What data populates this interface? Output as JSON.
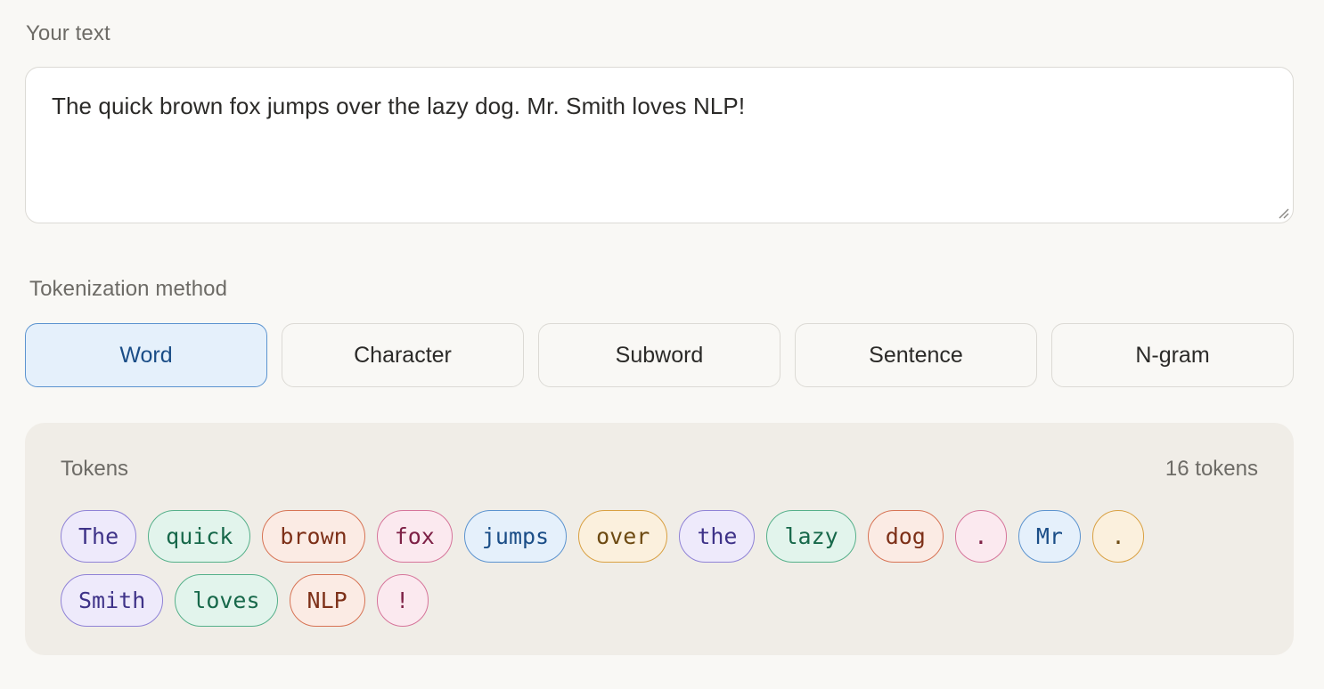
{
  "input": {
    "label": "Your text",
    "value": "The quick brown fox jumps over the lazy dog. Mr. Smith loves NLP!"
  },
  "methods": {
    "label": "Tokenization method",
    "options": [
      "Word",
      "Character",
      "Subword",
      "Sentence",
      "N-gram"
    ],
    "selected": "Word"
  },
  "tokens": {
    "title": "Tokens",
    "count_label": "16 tokens",
    "items": [
      "The",
      "quick",
      "brown",
      "fox",
      "jumps",
      "over",
      "the",
      "lazy",
      "dog",
      ".",
      "Mr",
      ".",
      "Smith",
      "loves",
      "NLP",
      "!"
    ],
    "palette": [
      {
        "bg": "#eeeafb",
        "border": "#8f82d6",
        "text": "#3e3288"
      },
      {
        "bg": "#e2f4ec",
        "border": "#55b08a",
        "text": "#17684a"
      },
      {
        "bg": "#fbebe4",
        "border": "#d77354",
        "text": "#7d3018"
      },
      {
        "bg": "#fbe9ef",
        "border": "#d6749a",
        "text": "#7e2146"
      },
      {
        "bg": "#e5f0fb",
        "border": "#5b93cf",
        "text": "#1a4d87"
      },
      {
        "bg": "#fbf0dd",
        "border": "#d9a041",
        "text": "#6d4a12"
      }
    ]
  },
  "colors": {
    "background": "#f9f8f5",
    "panel": "#f0ede7",
    "accent": "#5b93cf"
  }
}
